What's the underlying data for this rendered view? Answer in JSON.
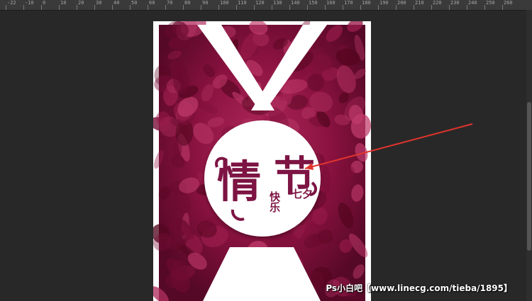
{
  "ruler": {
    "marks": [
      "-22",
      "-10",
      "0",
      "10",
      "20",
      "30",
      "40",
      "50",
      "60",
      "70",
      "80",
      "90",
      "100",
      "110",
      "120",
      "130",
      "140",
      "150",
      "160",
      "170",
      "180",
      "190",
      "200",
      "210",
      "220",
      "230",
      "240",
      "250",
      "260"
    ]
  },
  "poster": {
    "title_main": "情",
    "title_second": "节",
    "subtitle_left": "快乐",
    "subtitle_right": "七夕"
  },
  "watermark": "Ps小白吧【www.linecg.com/tieba/1895】",
  "colors": {
    "workspace": "#282828",
    "document": "#ffffff",
    "petals": "#8a1240",
    "title": "#7d1443",
    "annotation_arrow": "#e0342c"
  }
}
